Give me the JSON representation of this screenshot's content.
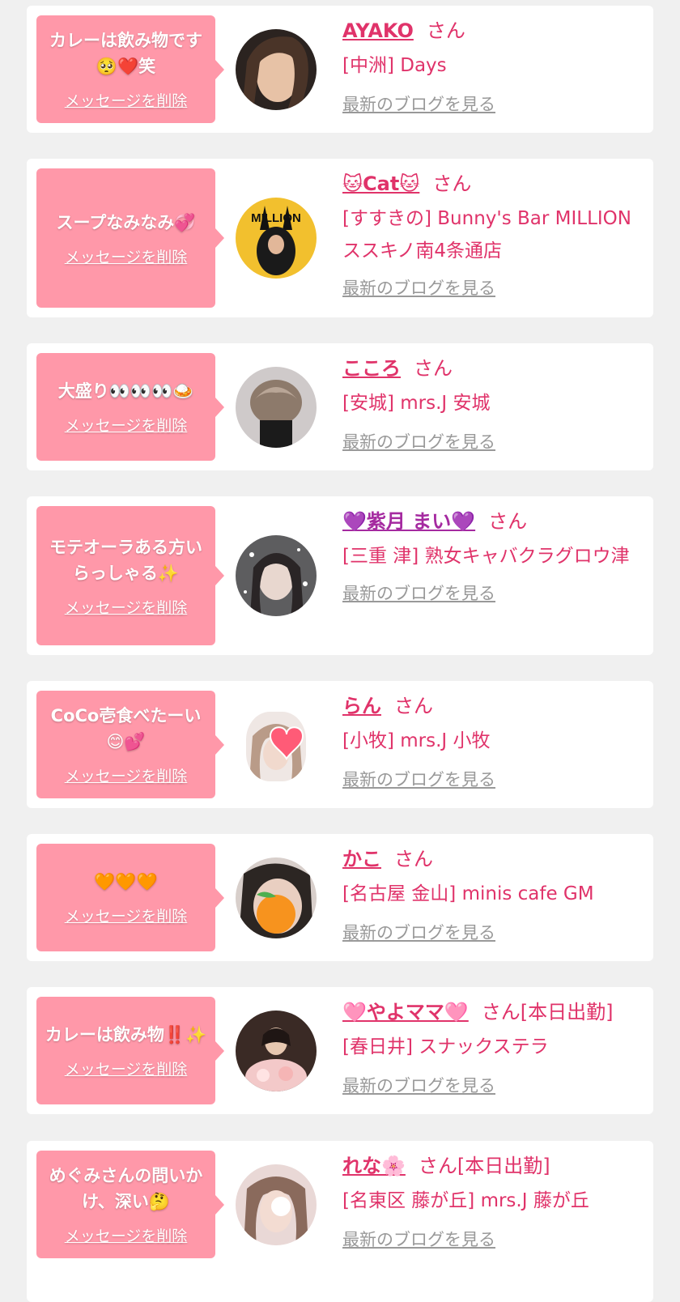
{
  "theme": {
    "accent": "#e0336a",
    "bubble": "#ff98a9",
    "link_gray": "#999999"
  },
  "cards": [
    {
      "message": "カレーは飲み物です🥺❤️笑",
      "delete_label": "メッセージを削除",
      "name": "AYAKO",
      "honorific": "さん",
      "shop": "[中洲] Days",
      "blog_link": "最新のブログを見る"
    },
    {
      "message": "スープなみなみ💞",
      "delete_label": "メッセージを削除",
      "name": "🐱Cat🐱",
      "honorific": "さん",
      "shop": "[すすきの] Bunny's Bar MILLION ススキノ南4条通店",
      "blog_link": "最新のブログを見る",
      "avatar_text": "MILLION"
    },
    {
      "message": "大盛り👀👀👀🍛",
      "delete_label": "メッセージを削除",
      "name": "こころ",
      "honorific": "さん",
      "shop": "[安城] mrs.J 安城",
      "blog_link": "最新のブログを見る"
    },
    {
      "message": "モテオーラある方いらっしゃる✨",
      "delete_label": "メッセージを削除",
      "name": "💜紫月 まい💜",
      "honorific": "さん",
      "shop": "[三重 津] 熟女キャバクラグロウ津",
      "blog_link": "最新のブログを見る"
    },
    {
      "message": "CoCo壱食べたーい😊💕",
      "delete_label": "メッセージを削除",
      "name": "らん",
      "honorific": "さん",
      "shop": "[小牧] mrs.J 小牧",
      "blog_link": "最新のブログを見る"
    },
    {
      "message": "🧡🧡🧡",
      "delete_label": "メッセージを削除",
      "name": "かこ",
      "honorific": "さん",
      "shop": "[名古屋 金山] minis cafe GM",
      "blog_link": "最新のブログを見る"
    },
    {
      "message": "カレーは飲み物‼️✨",
      "delete_label": "メッセージを削除",
      "name": "🩷やよママ🩷",
      "honorific": "さん[本日出勤]",
      "shop": "[春日井] スナックステラ",
      "blog_link": "最新のブログを見る"
    },
    {
      "message": "めぐみさんの問いかけ、深い🤔",
      "delete_label": "メッセージを削除",
      "name": "れな🌸",
      "honorific": "さん[本日出勤]",
      "shop": "[名東区 藤が丘] mrs.J 藤が丘",
      "blog_link": "最新のブログを見る"
    }
  ]
}
